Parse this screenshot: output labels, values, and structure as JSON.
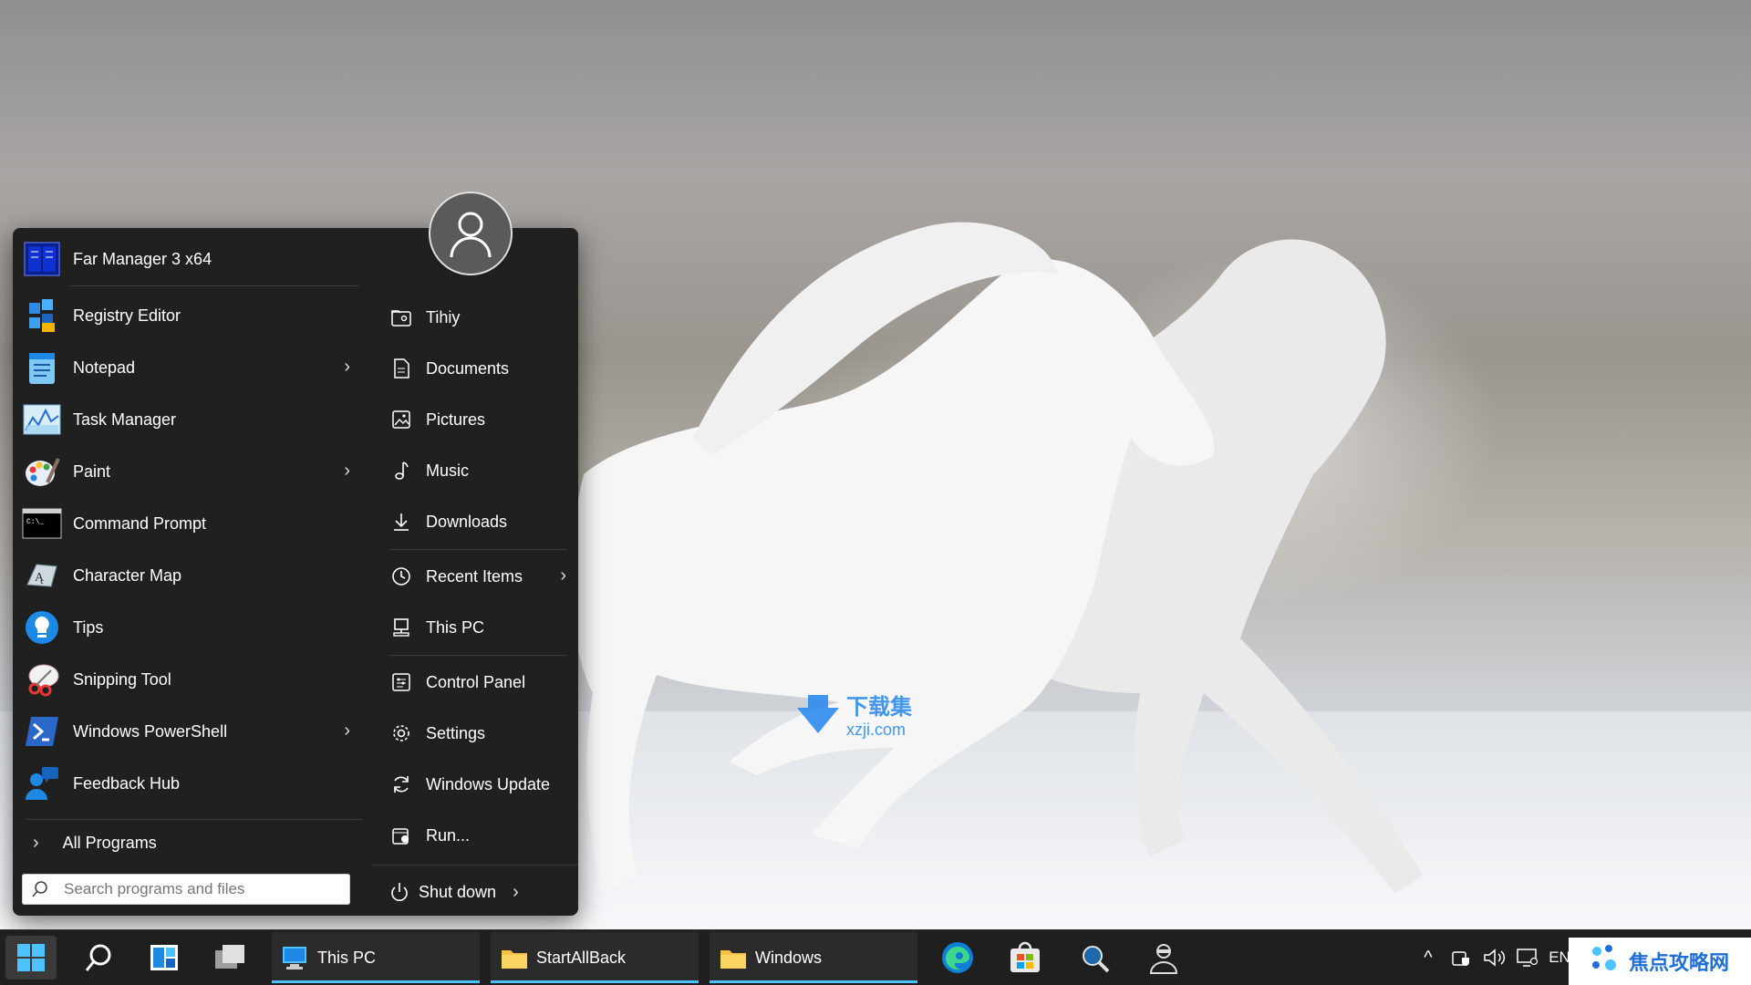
{
  "start_menu": {
    "pinned_program": "Far Manager 3 x64",
    "programs": [
      {
        "label": "Registry Editor",
        "has_submenu": false,
        "icon": "registry-icon"
      },
      {
        "label": "Notepad",
        "has_submenu": true,
        "icon": "notepad-icon"
      },
      {
        "label": "Task Manager",
        "has_submenu": false,
        "icon": "task-manager-icon"
      },
      {
        "label": "Paint",
        "has_submenu": true,
        "icon": "paint-icon"
      },
      {
        "label": "Command Prompt",
        "has_submenu": false,
        "icon": "cmd-icon"
      },
      {
        "label": "Character Map",
        "has_submenu": false,
        "icon": "charmap-icon"
      },
      {
        "label": "Tips",
        "has_submenu": false,
        "icon": "tips-icon"
      },
      {
        "label": "Snipping Tool",
        "has_submenu": false,
        "icon": "snipping-icon"
      },
      {
        "label": "Windows PowerShell",
        "has_submenu": true,
        "icon": "powershell-icon"
      },
      {
        "label": "Feedback Hub",
        "has_submenu": false,
        "icon": "feedback-icon"
      }
    ],
    "all_programs": "All Programs",
    "search_placeholder": "Search programs and files",
    "right_items": [
      {
        "label": "Tihiy",
        "icon": "user-folder-icon"
      },
      {
        "label": "Documents",
        "icon": "document-icon"
      },
      {
        "label": "Pictures",
        "icon": "picture-icon"
      },
      {
        "label": "Music",
        "icon": "music-icon"
      },
      {
        "label": "Downloads",
        "icon": "download-icon"
      },
      {
        "label": "Recent Items",
        "icon": "clock-icon",
        "has_submenu": true
      },
      {
        "label": "This PC",
        "icon": "computer-icon"
      },
      {
        "label": "Control Panel",
        "icon": "control-panel-icon"
      },
      {
        "label": "Settings",
        "icon": "gear-icon"
      },
      {
        "label": "Windows Update",
        "icon": "update-icon"
      },
      {
        "label": "Run...",
        "icon": "run-icon"
      }
    ],
    "shutdown": "Shut down"
  },
  "taskbar": {
    "apps": [
      {
        "label": "This PC",
        "icon": "computer-icon"
      },
      {
        "label": "StartAllBack",
        "icon": "folder-icon"
      },
      {
        "label": "Windows",
        "icon": "folder-icon"
      }
    ],
    "tray_language": "EN",
    "accent": "#4cc2ff"
  },
  "watermarks": {
    "center_cn": "下载集",
    "center_url": "xzji.com",
    "corner": "焦点攻略网"
  }
}
